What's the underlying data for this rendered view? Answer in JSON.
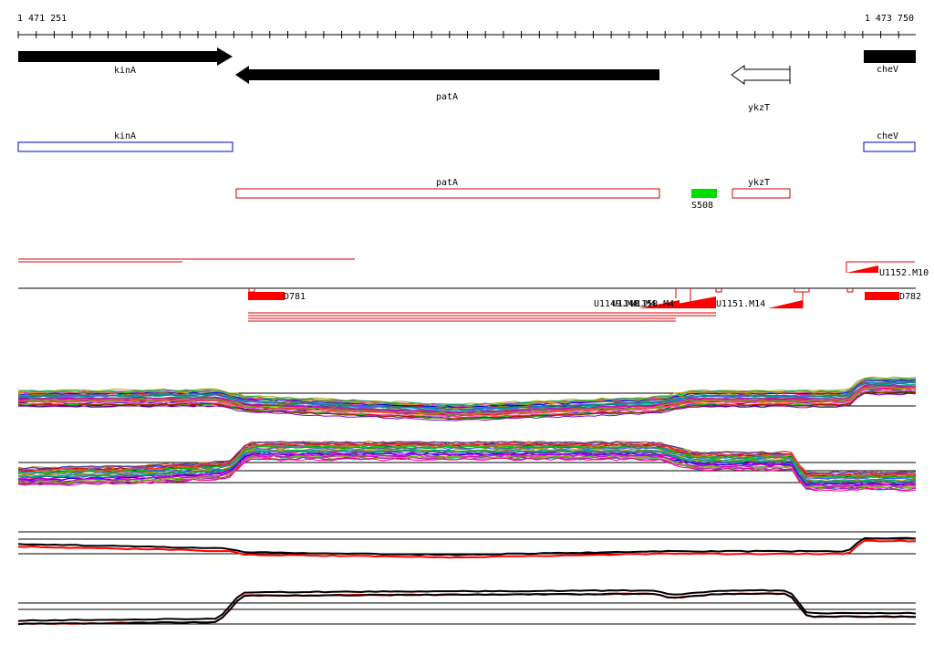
{
  "coords": {
    "start": "1 471 251",
    "end": "1 473 750"
  },
  "genes": [
    {
      "label": "kinA",
      "strand": "+",
      "fill": "#000000"
    },
    {
      "label": "patA",
      "strand": "-",
      "fill": "#000000"
    },
    {
      "label": "ykzT",
      "strand": "-",
      "fill": "#ffffff"
    },
    {
      "label": "cheV",
      "strand": "+",
      "fill": "#000000"
    }
  ],
  "annotations": [
    {
      "label": "kinA",
      "color": "#0000cc"
    },
    {
      "label": "cheV",
      "color": "#0000cc"
    },
    {
      "label": "patA",
      "color": "#cc0000"
    },
    {
      "label": "ykzT",
      "color": "#cc0000"
    }
  ],
  "small_rna": {
    "label": "S508",
    "color": "#00dd00"
  },
  "features": {
    "upper": {
      "label": "U1152.M10"
    },
    "lower": [
      {
        "label": "D781"
      },
      {
        "label": "U1149.M4"
      },
      {
        "label": "U1148.M4"
      },
      {
        "label": "U1150.M4"
      },
      {
        "label": "U1151.M14"
      },
      {
        "label": "D782"
      }
    ]
  },
  "colors": {
    "feature_red": "#ff0000",
    "line_red": "#dd0000",
    "axis": "#000000"
  },
  "expression_panels": [
    {
      "name": "expression-panel-1",
      "kind": "many-conditions"
    },
    {
      "name": "expression-panel-2",
      "kind": "many-conditions"
    },
    {
      "name": "expression-panel-3",
      "kind": "summary"
    },
    {
      "name": "expression-panel-4",
      "kind": "summary"
    }
  ]
}
